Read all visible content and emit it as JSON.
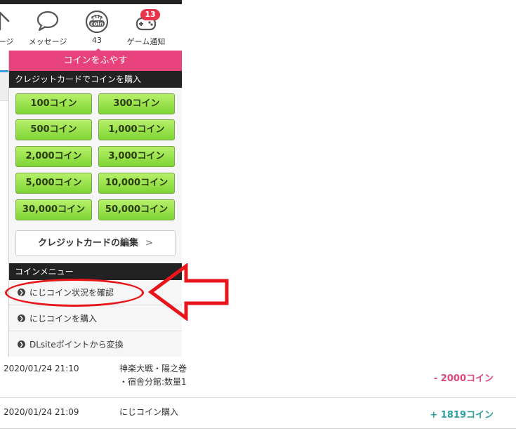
{
  "header": {
    "nav": [
      {
        "label": "ページ",
        "icon": "home-icon"
      },
      {
        "label": "メッセージ",
        "icon": "message-icon"
      },
      {
        "label": "43",
        "icon": "coin-icon"
      },
      {
        "label": "ゲーム通知",
        "icon": "game-controller-icon",
        "badge": "13"
      }
    ]
  },
  "dropdown": {
    "title": "コインをふやす",
    "credit_section": "クレジットカードでコインを購入",
    "coin_buttons": [
      "100コイン",
      "300コイン",
      "500コイン",
      "1,000コイン",
      "2,000コイン",
      "3,000コイン",
      "5,000コイン",
      "10,000コイン",
      "30,000コイン",
      "50,000コイン"
    ],
    "edit_card": "クレジットカードの編集",
    "edit_chevron": ">",
    "menu_section": "コインメニュー",
    "menu_items": [
      "にじコイン状況を確認",
      "にじコインを購入",
      "DLsiteポイントから変換"
    ]
  },
  "history": [
    {
      "date": "2020/01/24 21:10",
      "desc_line1": "神楽大戦・陽之巻",
      "desc_line2": "・宿舎分館:数量1",
      "amount": "- 2000コイン"
    },
    {
      "date": "2020/01/24 21:09",
      "desc_line1": "にじコイン購入",
      "desc_line2": "",
      "amount": "+ 1819コイン"
    }
  ],
  "colors": {
    "accent_pink": "#e8427c",
    "button_green": "#7ed534",
    "annotation_red": "#e8161b",
    "minus_color": "#e0467c",
    "plus_color": "#2aa0a0"
  }
}
